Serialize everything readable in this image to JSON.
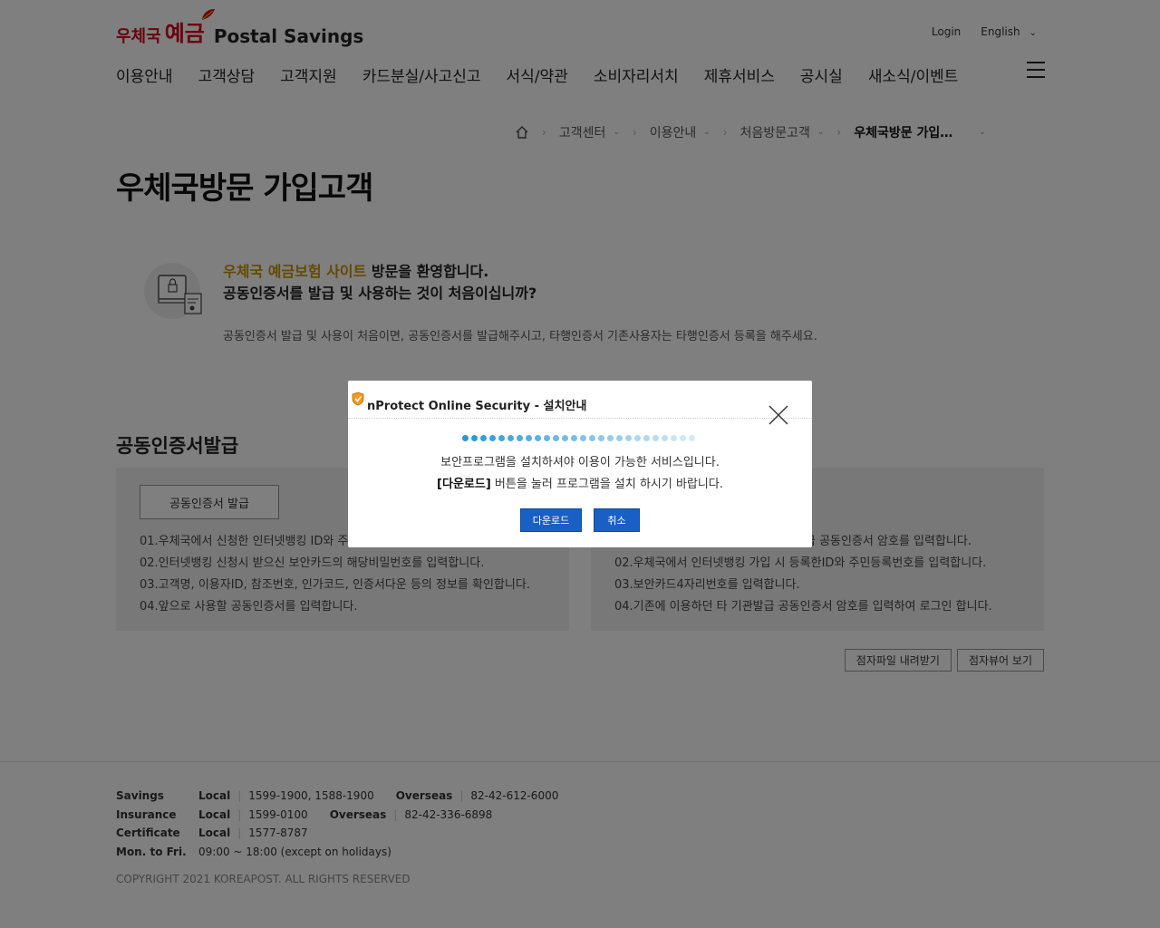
{
  "header": {
    "logo_small": "우체국",
    "logo_big": "예금",
    "logo_en": "Postal Savings",
    "login": "Login",
    "language": "English"
  },
  "nav": [
    "이용안내",
    "고객상담",
    "고객지원",
    "카드분실/사고신고",
    "서식/약관",
    "소비자리서치",
    "제휴서비스",
    "공시실",
    "새소식/이벤트"
  ],
  "breadcrumb": {
    "items": [
      "고객센터",
      "이용안내",
      "처음방문고객"
    ],
    "current": "우체국방문 가입고객"
  },
  "page_title": "우체국방문 가입고객",
  "welcome": {
    "highlight": "우체국 예금보험 사이트",
    "line1_rest": " 방문을 환영합니다.",
    "line2": "공동인증서를 발급 및 사용하는 것이 처음이십니까?",
    "desc": "공동인증서 발급 및 사용이 처음이면, 공동인증서를 발급해주시고, 타행인증서 기존사용자는 타행인증서 등록을 해주세요."
  },
  "section_title": "공동인증서발급",
  "left_panel": {
    "button": "공동인증서 발급",
    "steps": [
      "01.우체국에서 신청한 인터넷뱅킹 ID와 주",
      "02.인터넷뱅킹 신청시 받으신 보안카드의 해당비밀번호를 입력합니다.",
      "03.고객명, 이용자ID, 참조번호, 인가코드, 인증서다운 등의 정보를 확인합니다.",
      "04.앞으로 사용할 공동인증서를 입력합니다."
    ]
  },
  "right_panel": {
    "steps": [
      "급 공동인증서 암호를 입력합니다.",
      "02.우체국에서 인터넷뱅킹 가입 시 등록한ID와 주민등록번호를 입력합니다.",
      "03.보안카드4자리번호를 입력합니다.",
      "04.기존에 이용하던 타 기관발급 공동인증서 암호를 입력하여 로그인 합니다."
    ]
  },
  "bottom_buttons": [
    "점자파일 내려받기",
    "점자뷰어 보기"
  ],
  "footer": {
    "savings": {
      "label": "Savings",
      "local_label": "Local",
      "local": "1599-1900, 1588-1900",
      "overseas_label": "Overseas",
      "overseas": "82-42-612-6000"
    },
    "insurance": {
      "label": "Insurance",
      "local_label": "Local",
      "local": "1599-0100",
      "overseas_label": "Overseas",
      "overseas": "82-42-336-6898"
    },
    "certificate": {
      "label": "Certificate",
      "local_label": "Local",
      "local": "1577-8787"
    },
    "hours": {
      "label": "Mon. to Fri.",
      "value": "09:00 ~ 18:00 (except on holidays)"
    },
    "copyright": "COPYRIGHT 2021 KOREAPOST. ALL RIGHTS RESERVED"
  },
  "modal": {
    "title": "nProtect Online Security - 설치안내",
    "line1": "보안프로그램을 설치하셔야 이용이 가능한 서비스입니다.",
    "line2_bold": "[다운로드]",
    "line2_rest": " 버튼을 눌러 프로그램을 설치 하시기 바랍니다.",
    "download": "다운로드",
    "cancel": "취소"
  },
  "colors": {
    "brand_red": "#d6001c",
    "highlight": "#c79400",
    "modal_button": "#1a5fc4"
  },
  "icons": [
    "home-icon",
    "hamburger-menu-icon",
    "certificate-lock-icon",
    "shield-icon",
    "close-icon"
  ]
}
